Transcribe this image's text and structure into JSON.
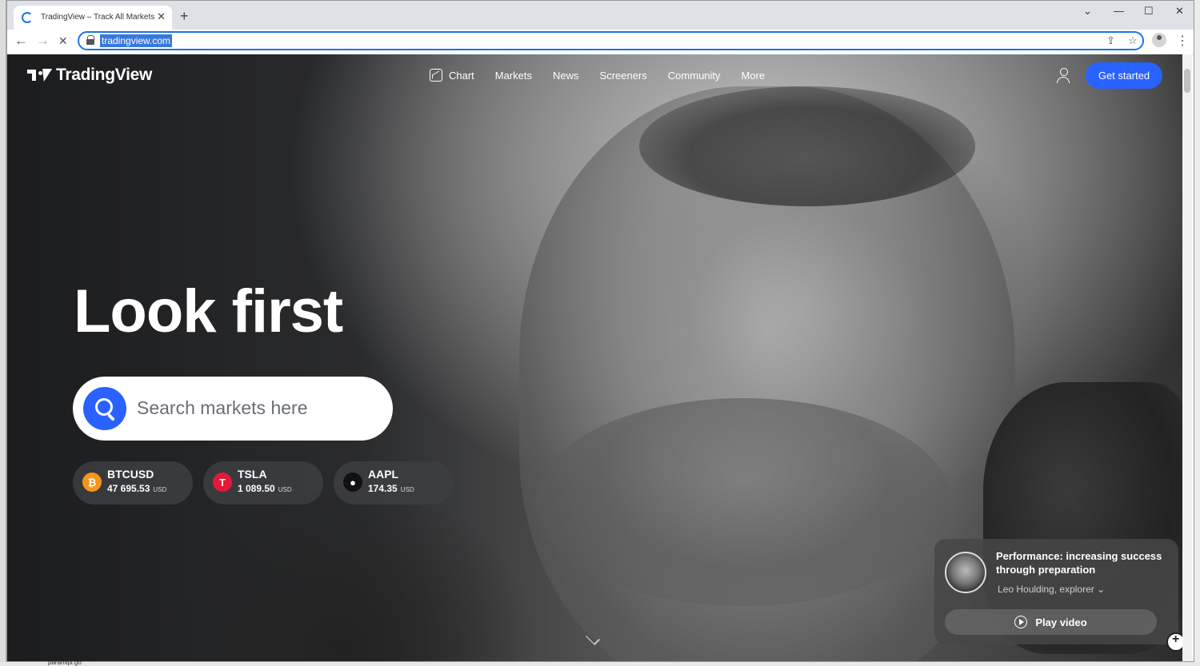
{
  "browser": {
    "tab_title": "TradingView – Track All Markets",
    "tab_close": "✕",
    "new_tab": "+",
    "url": "tradingview.com",
    "window_controls": {
      "tabsearch": "⌄",
      "minimize": "—",
      "maximize": "☐",
      "close": "✕"
    },
    "nav": {
      "back": "←",
      "forward": "→",
      "stop": "✕"
    },
    "omni_icons": {
      "share": "⇪",
      "bookmark": "☆"
    },
    "menu": "⋮"
  },
  "site": {
    "logo_text": "TradingView",
    "nav_items": [
      "Chart",
      "Markets",
      "News",
      "Screeners",
      "Community",
      "More"
    ],
    "cta_label": "Get started"
  },
  "hero": {
    "title": "Look first",
    "search_placeholder": "Search markets here"
  },
  "tickers": [
    {
      "symbol": "BTCUSD",
      "price": "47 695.53",
      "currency": "USD",
      "icon": "₿",
      "color": "#f7931a"
    },
    {
      "symbol": "TSLA",
      "price": "1 089.50",
      "currency": "USD",
      "icon": "T",
      "color": "#e31937"
    },
    {
      "symbol": "AAPL",
      "price": "174.35",
      "currency": "USD",
      "icon": "",
      "color": "#111111"
    }
  ],
  "video_card": {
    "title": "Performance: increasing success through preparation",
    "subtitle": "Leo Houlding, explorer",
    "chevron": "⌄",
    "play_label": "Play video"
  },
  "taskbar_text": "paramlpi.go",
  "colors": {
    "accent": "#2962ff"
  }
}
